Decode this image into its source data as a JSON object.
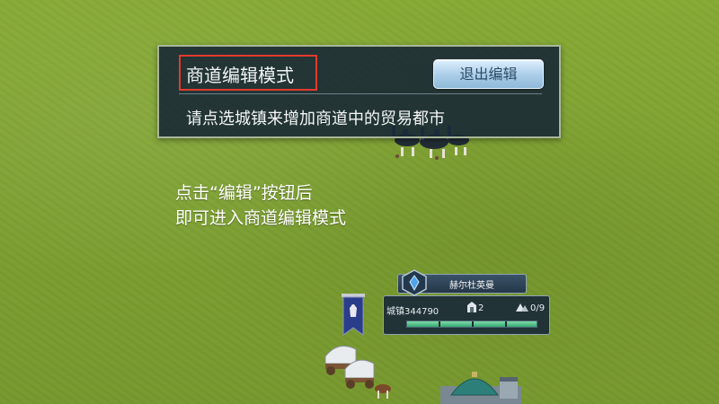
{
  "edit_panel": {
    "title": "商道编辑模式",
    "exit_button_label": "退出编辑",
    "instruction": "请点选城镇来增加商道中的贸易都市"
  },
  "tutorial_tip": {
    "line1": "点击“编辑”按钮后",
    "line2": "即可进入商道编辑模式"
  },
  "city_card": {
    "name": "赫尔杜英曼",
    "town_label": "城镇344790",
    "building_count": "2",
    "troop_count": "0/9",
    "health_fraction": 1.0
  },
  "icons": {
    "emblem": "blue-crystal-emblem-icon",
    "building": "building-icon",
    "troops": "tent-icon",
    "flag": "guild-flag-icon"
  },
  "colors": {
    "grass": "#7fa233",
    "panel_bg": "#182834",
    "highlight_border": "#e33a2e",
    "button_top": "#dcefff",
    "health_green": "#36a871"
  }
}
